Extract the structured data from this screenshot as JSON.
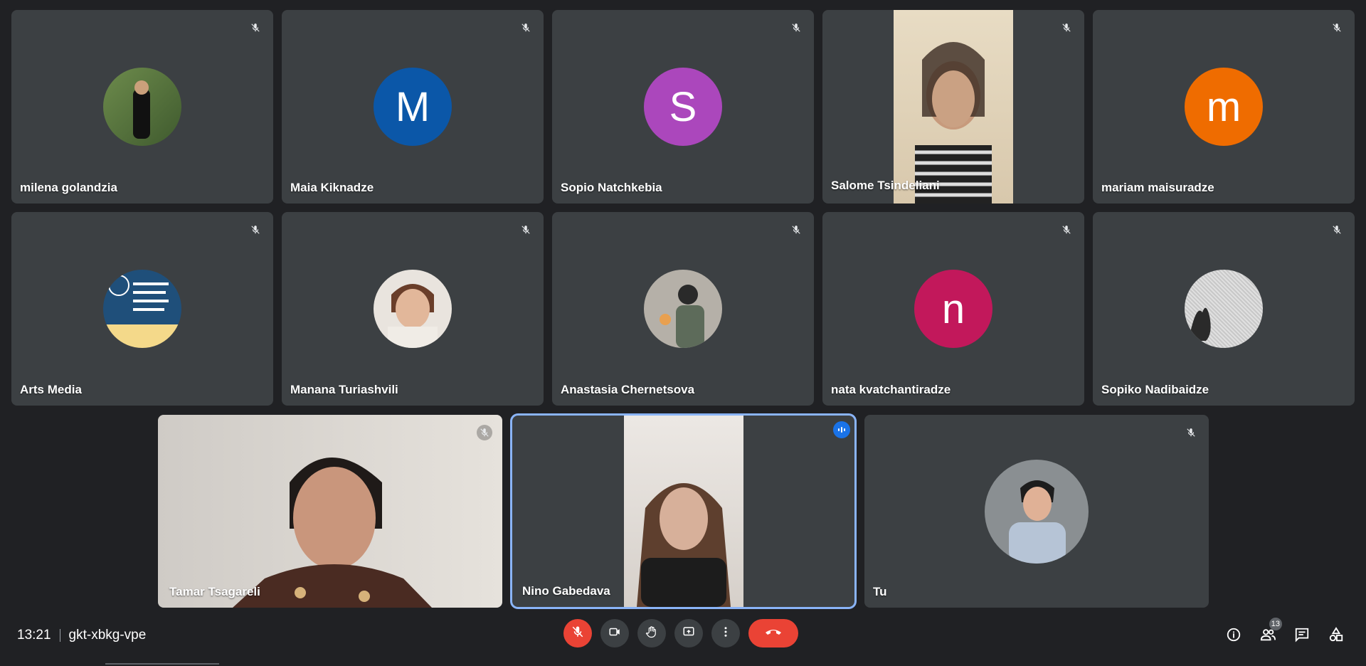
{
  "participants": [
    {
      "name": "milena golandzia",
      "avatar": "photo",
      "muted": true
    },
    {
      "name": "Maia Kiknadze",
      "initial": "M",
      "color": "#0b57a8",
      "muted": true
    },
    {
      "name": "Sopio Natchkebia",
      "initial": "S",
      "color": "#ab47bc",
      "muted": true
    },
    {
      "name": "Salome Tsindeliani",
      "avatar": "video",
      "muted": true
    },
    {
      "name": "mariam maisuradze",
      "initial": "m",
      "color": "#ef6c00",
      "muted": true
    },
    {
      "name": "Arts Media",
      "avatar": "photo",
      "muted": true
    },
    {
      "name": "Manana Turiashvili",
      "avatar": "photo",
      "muted": true
    },
    {
      "name": "Anastasia Chernetsova",
      "avatar": "photo",
      "muted": true
    },
    {
      "name": "nata kvatchantiradze",
      "initial": "n",
      "color": "#c2185b",
      "muted": true
    },
    {
      "name": "Sopiko Nadibaidze",
      "avatar": "photo",
      "muted": true
    },
    {
      "name": "Tamar Tsagareli",
      "avatar": "video",
      "muted": true
    },
    {
      "name": "Nino Gabedava",
      "avatar": "video",
      "speaking": true
    },
    {
      "name": "Tu",
      "avatar": "photo",
      "muted": true
    }
  ],
  "footer": {
    "time": "13:21",
    "meeting_code": "gkt-xbkg-vpe",
    "participant_count": "13"
  },
  "colors": {
    "background": "#202124",
    "tile": "#3c4043",
    "end_call": "#ea4335",
    "speaking_border": "#8ab4f8"
  },
  "icons": [
    "mic-off-icon",
    "camera-icon",
    "raise-hand-icon",
    "present-screen-icon",
    "more-options-icon",
    "end-call-icon",
    "info-icon",
    "people-icon",
    "chat-icon",
    "activities-icon",
    "speaking-indicator-icon"
  ]
}
